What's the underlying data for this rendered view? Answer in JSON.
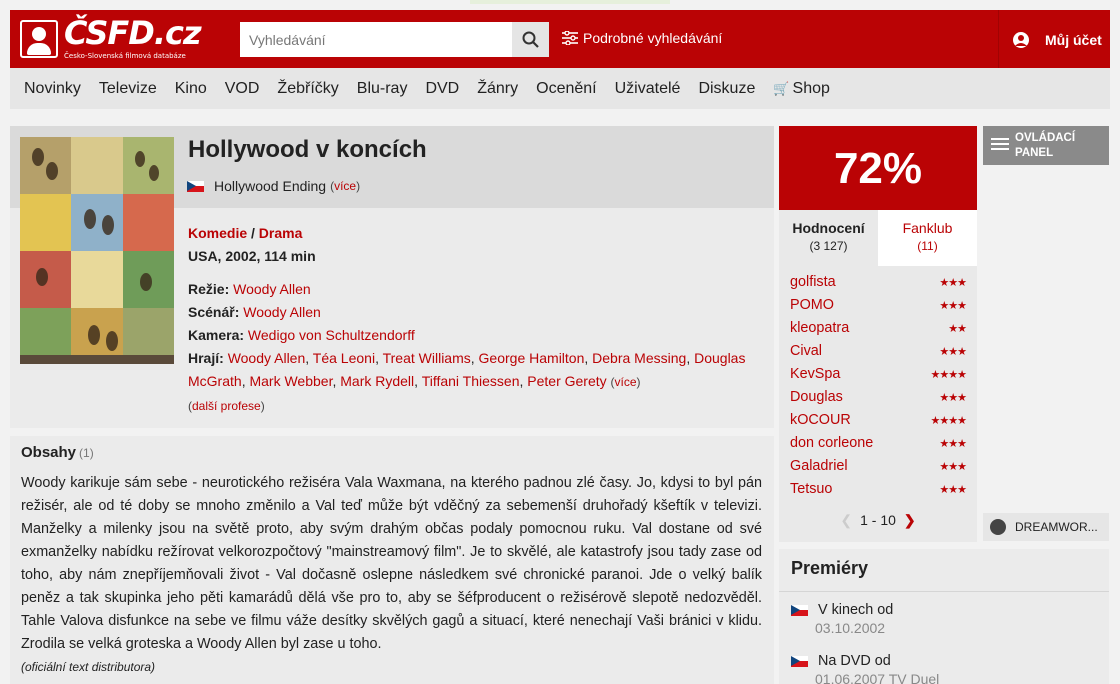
{
  "header": {
    "brand": "ČSFD.cz",
    "brand_sub": "Česko-Slovenská filmová databáze",
    "search_placeholder": "Vyhledávání",
    "advanced_search": "Podrobné vyhledávání",
    "account": "Můj účet",
    "accent_color": "#ba0305"
  },
  "nav": {
    "items": [
      "Novinky",
      "Televize",
      "Kino",
      "VOD",
      "Žebříčky",
      "Blu-ray",
      "DVD",
      "Žánry",
      "Ocenění",
      "Uživatelé",
      "Diskuze"
    ],
    "shop": "Shop"
  },
  "film": {
    "title": "Hollywood v koncích",
    "original_title": "Hollywood Ending",
    "original_more": "více",
    "genre_1": "Komedie",
    "genre_sep": " / ",
    "genre_2": "Drama",
    "origin": "USA, 2002, 114 min",
    "directing_label": "Režie:",
    "directors": "Woody Allen",
    "screenplay_label": "Scénář:",
    "screenplay": "Woody Allen",
    "camera_label": "Kamera:",
    "camera": "Wedigo von Schultzendorff",
    "cast_label": "Hrají:",
    "cast": [
      "Woody Allen",
      "Téa Leoni",
      "Treat Williams",
      "George Hamilton",
      "Debra Messing",
      "Douglas McGrath",
      "Mark Webber",
      "Mark Rydell",
      "Tiffani Thiessen",
      "Peter Gerety"
    ],
    "cast_more": "více",
    "more_professions": "další profese"
  },
  "plot": {
    "heading": "Obsahy",
    "count": "(1)",
    "text": "Woody karikuje sám sebe - neurotického režiséra Vala Waxmana, na kterého padnou zlé časy. Jo, kdysi to byl pán režisér, ale od té doby se mnoho změnilo a Val teď může být vděčný za sebemenší druhořadý kšeftík v televizi. Manželky a milenky jsou na světě proto, aby svým drahým občas podaly pomocnou ruku. Val dostane od své exmanželky nabídku režírovat velkorozpočtový \"mainstreamový film\". Je to skvělé, ale katastrofy jsou tady zase od toho, aby nám znepříjemňovali život - Val dočasně oslepne následkem své chronické paranoi. Jde o velký balík peněz a tak skupinka jeho pěti kamarádů dělá vše pro to, aby se šéfproducent o režisérově slepotě nedozvěděl. Tahle Valova disfunkce na sebe ve filmu váže desítky skvělých gagů a situací, které nenechají Vaši bránici v klidu. Zrodila se velká groteska a Woody Allen byl zase u toho.",
    "source": "(oficiální text distributora)"
  },
  "rating": {
    "percent": "72%",
    "tab_ratings": "Hodnocení",
    "tab_ratings_count": "(3 127)",
    "tab_fanclub": "Fanklub",
    "tab_fanclub_count": "(11)",
    "users": [
      {
        "name": "golfista",
        "stars": "★★★"
      },
      {
        "name": "POMO",
        "stars": "★★★"
      },
      {
        "name": "kleopatra",
        "stars": "★★"
      },
      {
        "name": "Cival",
        "stars": "★★★"
      },
      {
        "name": "KevSpa",
        "stars": "★★★★"
      },
      {
        "name": "Douglas",
        "stars": "★★★"
      },
      {
        "name": "kOCOUR",
        "stars": "★★★★"
      },
      {
        "name": "don corleone",
        "stars": "★★★"
      },
      {
        "name": "Galadriel",
        "stars": "★★★"
      },
      {
        "name": "Tetsuo",
        "stars": "★★★"
      }
    ],
    "pager": "1 - 10"
  },
  "control_panel": {
    "line1": "OVLÁDACÍ",
    "line2": "PANEL"
  },
  "vod_badge": "DREAMWOR...",
  "premieres": {
    "heading": "Premiéry",
    "items": [
      {
        "label": "V kinech od",
        "date": "03.10.2002"
      },
      {
        "label": "Na DVD od",
        "date": "01.06.2007 TV Duel"
      }
    ]
  }
}
